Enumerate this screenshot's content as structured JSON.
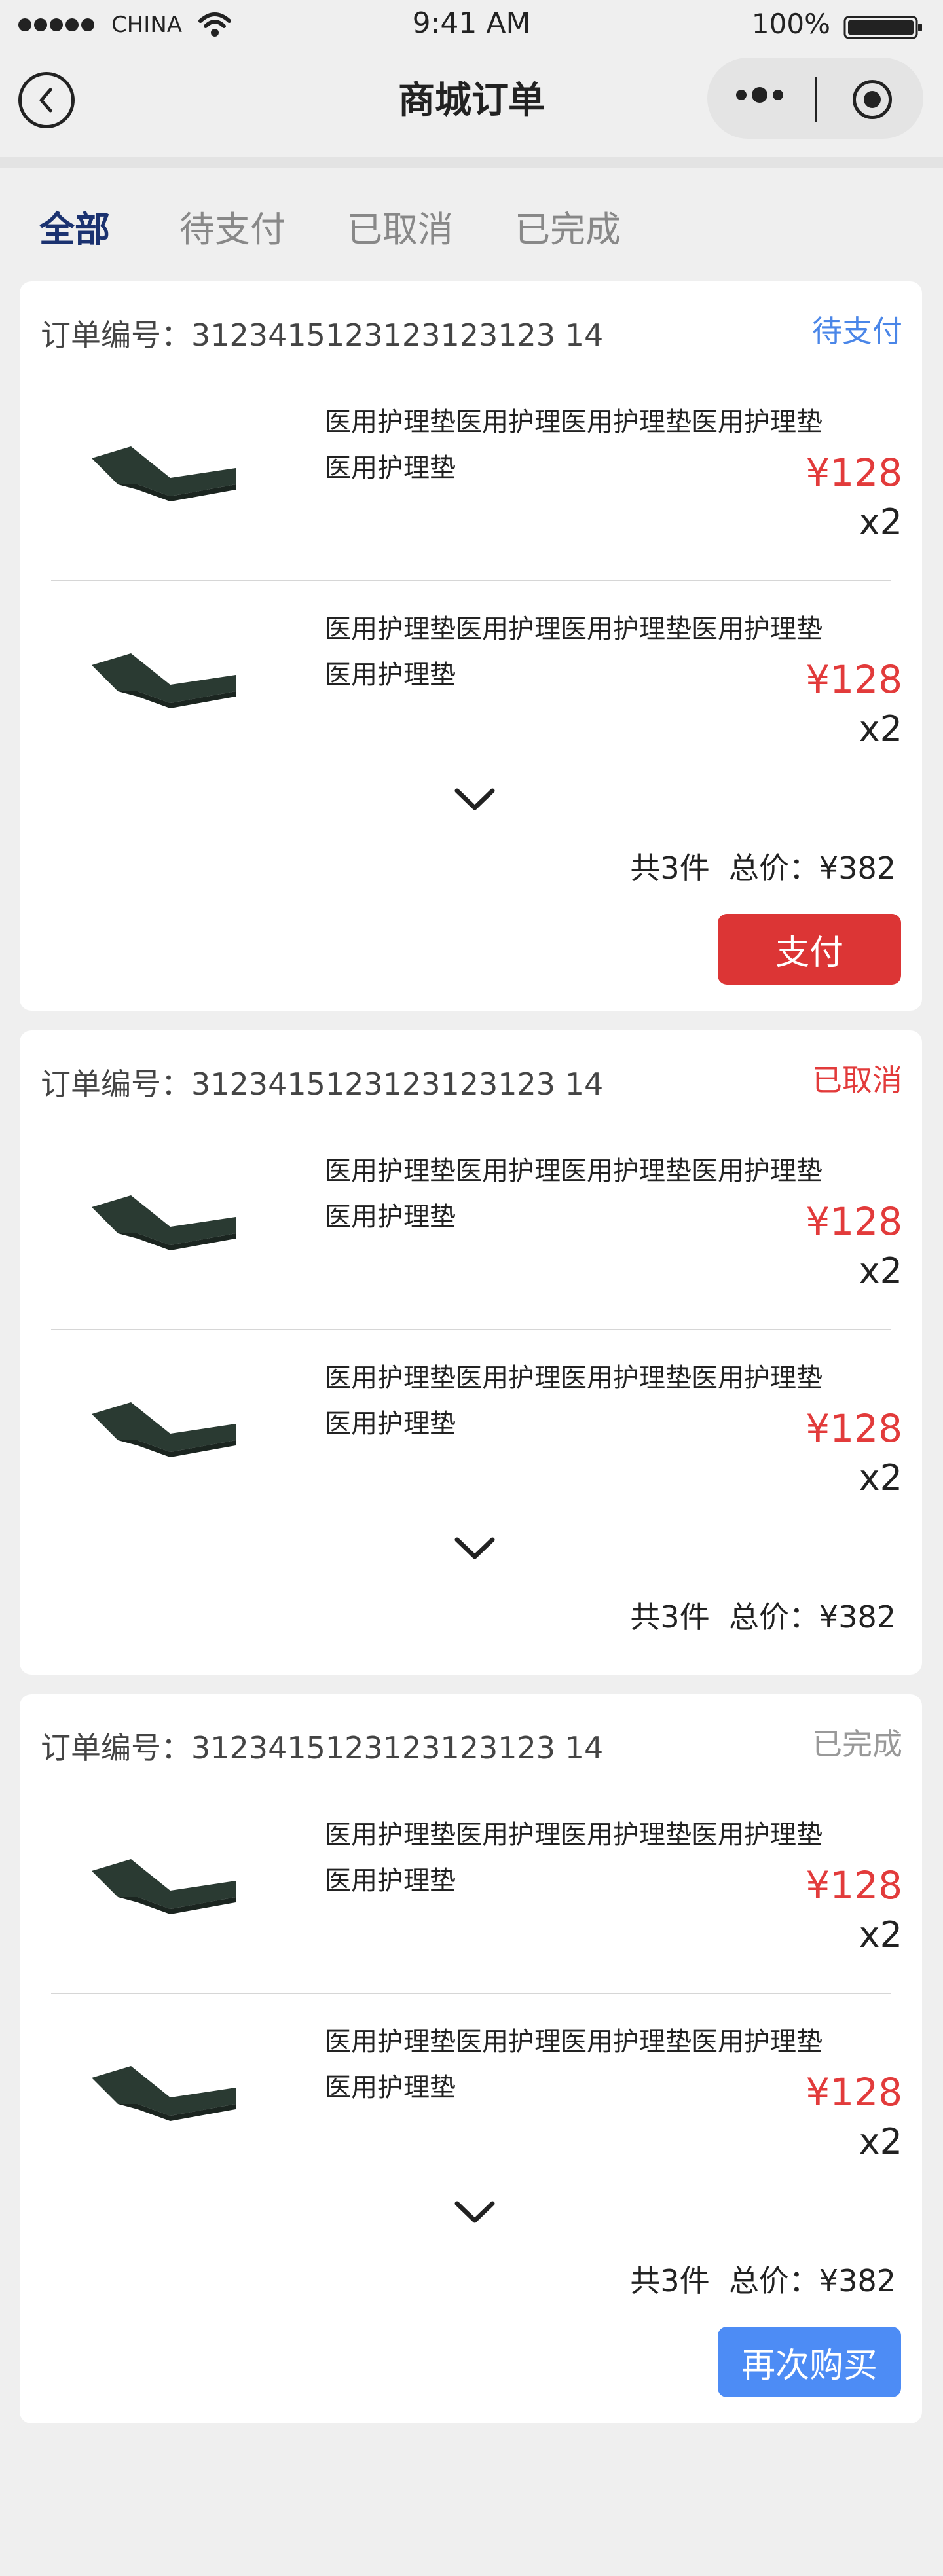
{
  "status_bar": {
    "carrier": "CHINA",
    "time": "9:41 AM",
    "battery": "100%"
  },
  "nav": {
    "title": "商城订单"
  },
  "tabs": [
    {
      "label": "全部",
      "active": true
    },
    {
      "label": "待支付",
      "active": false
    },
    {
      "label": "已取消",
      "active": false
    },
    {
      "label": "已完成",
      "active": false
    }
  ],
  "orders": [
    {
      "order_no_label": "订单编号：3123415123123123123 14",
      "status": "待支付",
      "status_color": "#4a86e8",
      "items": [
        {
          "name": "医用护理垫医用护理医用护理垫医用护理垫医用护理垫",
          "price": "¥128",
          "qty": "x2"
        },
        {
          "name": "医用护理垫医用护理医用护理垫医用护理垫医用护理垫",
          "price": "¥128",
          "qty": "x2"
        }
      ],
      "summary": "共3件  总价：¥382",
      "button": {
        "label": "支付",
        "color": "#dc3535"
      }
    },
    {
      "order_no_label": "订单编号：3123415123123123123 14",
      "status": "已取消",
      "status_color": "#e23b3b",
      "items": [
        {
          "name": "医用护理垫医用护理医用护理垫医用护理垫医用护理垫",
          "price": "¥128",
          "qty": "x2"
        },
        {
          "name": "医用护理垫医用护理医用护理垫医用护理垫医用护理垫",
          "price": "¥128",
          "qty": "x2"
        }
      ],
      "summary": "共3件  总价：¥382"
    },
    {
      "order_no_label": "订单编号：3123415123123123123 14",
      "status": "已完成",
      "status_color": "#999999",
      "items": [
        {
          "name": "医用护理垫医用护理医用护理垫医用护理垫医用护理垫",
          "price": "¥128",
          "qty": "x2"
        },
        {
          "name": "医用护理垫医用护理医用护理垫医用护理垫医用护理垫",
          "price": "¥128",
          "qty": "x2"
        }
      ],
      "summary": "共3件  总价：¥382",
      "button": {
        "label": "再次购买",
        "color": "#4d8cf5"
      }
    }
  ],
  "icons": {
    "back": "chevron-left-icon",
    "more": "more-dots-icon",
    "target": "target-icon",
    "expand": "chevron-down-icon"
  }
}
